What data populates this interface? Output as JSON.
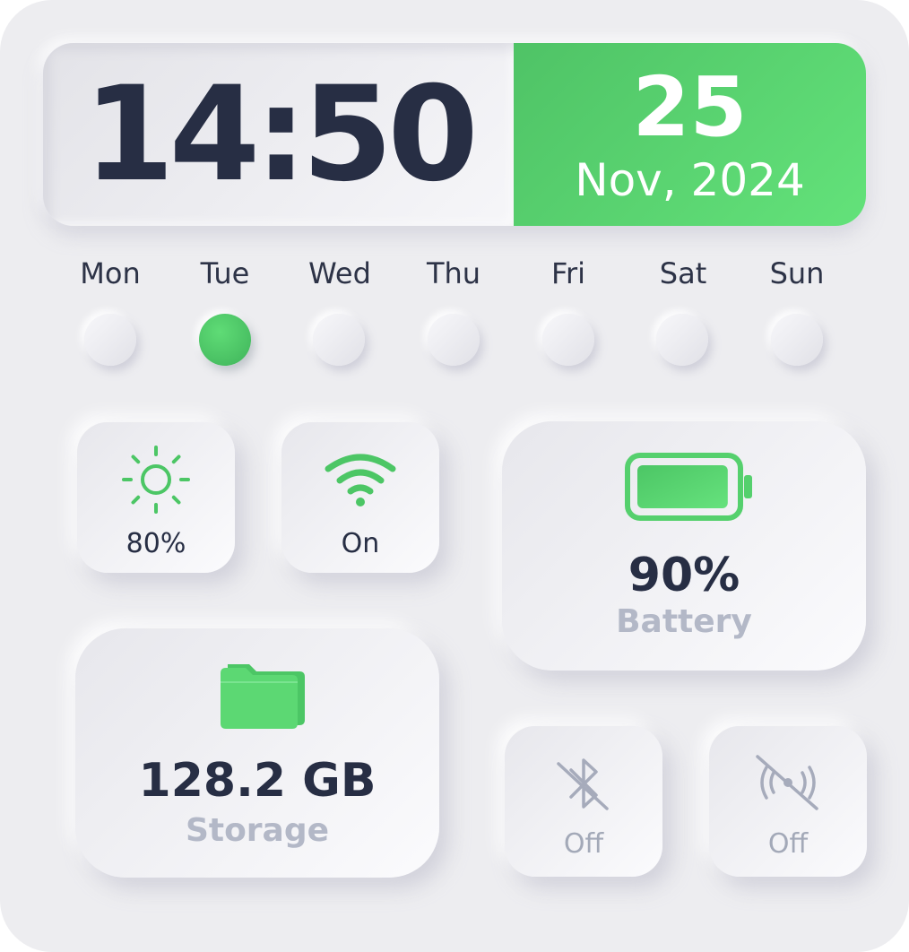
{
  "clock": {
    "time": "14:50",
    "day": "25",
    "month_year": "Nov, 2024"
  },
  "weekdays": [
    {
      "label": "Mon",
      "active": false
    },
    {
      "label": "Tue",
      "active": true
    },
    {
      "label": "Wed",
      "active": false
    },
    {
      "label": "Thu",
      "active": false
    },
    {
      "label": "Fri",
      "active": false
    },
    {
      "label": "Sat",
      "active": false
    },
    {
      "label": "Sun",
      "active": false
    }
  ],
  "brightness": {
    "value": "80%",
    "icon": "sun-icon"
  },
  "wifi": {
    "value": "On",
    "icon": "wifi-icon"
  },
  "battery": {
    "value": "90%",
    "label": "Battery",
    "icon": "battery-icon",
    "level": 0.9
  },
  "storage": {
    "value": "128.2 GB",
    "label": "Storage",
    "icon": "folder-icon"
  },
  "bluetooth": {
    "value": "Off",
    "icon": "bluetooth-off-icon"
  },
  "hotspot": {
    "value": "Off",
    "icon": "hotspot-off-icon"
  },
  "colors": {
    "accent": "#5bd872",
    "accent_dark": "#4fc366",
    "text": "#272e44",
    "muted": "#a3a9b8",
    "background": "#ededf0"
  }
}
